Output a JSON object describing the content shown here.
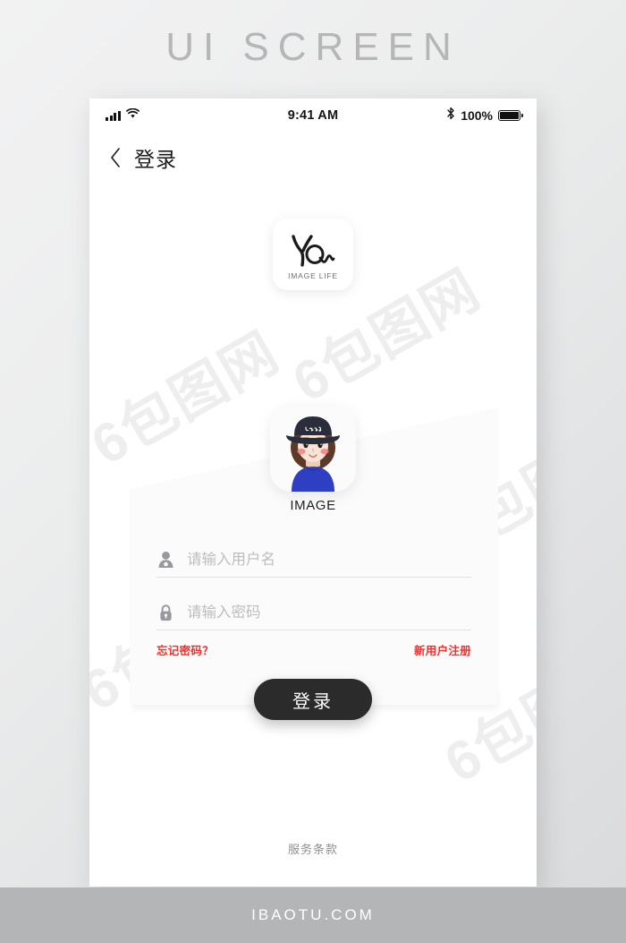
{
  "poster": {
    "title": "UI SCREEN",
    "footer_text": "IBAOTU.COM",
    "watermark_text": "6包图网"
  },
  "status_bar": {
    "time": "9:41 AM",
    "battery_percent": "100%",
    "icons": {
      "signal": "signal-bars-icon",
      "wifi": "wifi-icon",
      "bluetooth": "bluetooth-icon",
      "battery": "battery-full-icon"
    }
  },
  "nav": {
    "back_icon": "chevron-left-icon",
    "title": "登录"
  },
  "brand": {
    "logo_mark": "yq-handwritten-logo",
    "logo_subtitle": "IMAGE LIFE"
  },
  "avatar": {
    "image_name": "person-bucket-hat-avatar",
    "label": "IMAGE",
    "hat_text": "Jotty",
    "colors": {
      "hat": "#2a2d3c",
      "hair": "#5b3a2a",
      "skin": "#f7ddd0",
      "shirt": "#2f3fc4",
      "blush": "#f4837f"
    }
  },
  "form": {
    "username": {
      "icon": "user-icon",
      "placeholder": "请输入用户名",
      "value": ""
    },
    "password": {
      "icon": "lock-icon",
      "placeholder": "请输入密码",
      "value": ""
    },
    "forgot_password_label": "忘记密码？",
    "register_label": "新用户注册",
    "link_color": "#f0312c"
  },
  "actions": {
    "login_label": "登录",
    "login_bg": "#2b2b2b",
    "terms_label": "服务条款"
  }
}
